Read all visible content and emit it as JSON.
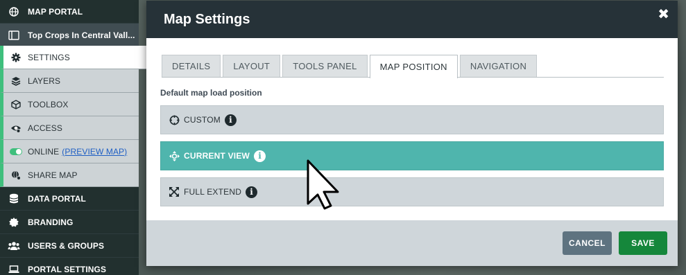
{
  "sidebar": {
    "items": [
      {
        "label": "MAP PORTAL",
        "icon": "globe-icon"
      },
      {
        "label": "Top Crops In Central Vall...",
        "icon": "sidebar-panel-icon"
      },
      {
        "label": "SETTINGS",
        "icon": "gear-icon"
      },
      {
        "label": "LAYERS",
        "icon": "layers-icon"
      },
      {
        "label": "TOOLBOX",
        "icon": "cube-icon"
      },
      {
        "label": "ACCESS",
        "icon": "eye-icon"
      },
      {
        "label": "ONLINE",
        "link": "(PREVIEW MAP)",
        "icon": "toggle-icon"
      },
      {
        "label": "SHARE MAP",
        "icon": "share-icon"
      },
      {
        "label": "DATA PORTAL",
        "icon": "database-icon"
      },
      {
        "label": "BRANDING",
        "icon": "badge-icon"
      },
      {
        "label": "USERS & GROUPS",
        "icon": "users-icon"
      },
      {
        "label": "PORTAL SETTINGS",
        "icon": "laptop-icon"
      }
    ]
  },
  "modal": {
    "title": "Map Settings",
    "close": "✖",
    "tabs": [
      "DETAILS",
      "LAYOUT",
      "TOOLS PANEL",
      "MAP POSITION",
      "NAVIGATION"
    ],
    "active_tab": "MAP POSITION",
    "section_label": "Default map load position",
    "options": [
      {
        "label": "CUSTOM",
        "icon": "crosshair-icon",
        "info": "i",
        "selected": false
      },
      {
        "label": "CURRENT VIEW",
        "icon": "move-arrows-icon",
        "info": "i",
        "selected": true
      },
      {
        "label": "FULL EXTEND",
        "icon": "expand-icon",
        "info": "i",
        "selected": false
      }
    ],
    "buttons": {
      "cancel": "CANCEL",
      "save": "SAVE"
    }
  },
  "colors": {
    "sidebar_bg": "#1e2b2f",
    "accent_green": "#3fbf7d",
    "selected_option": "#4fb5ad",
    "save_button": "#15873b",
    "cancel_button": "#5e7380",
    "header_bg": "#263238"
  }
}
